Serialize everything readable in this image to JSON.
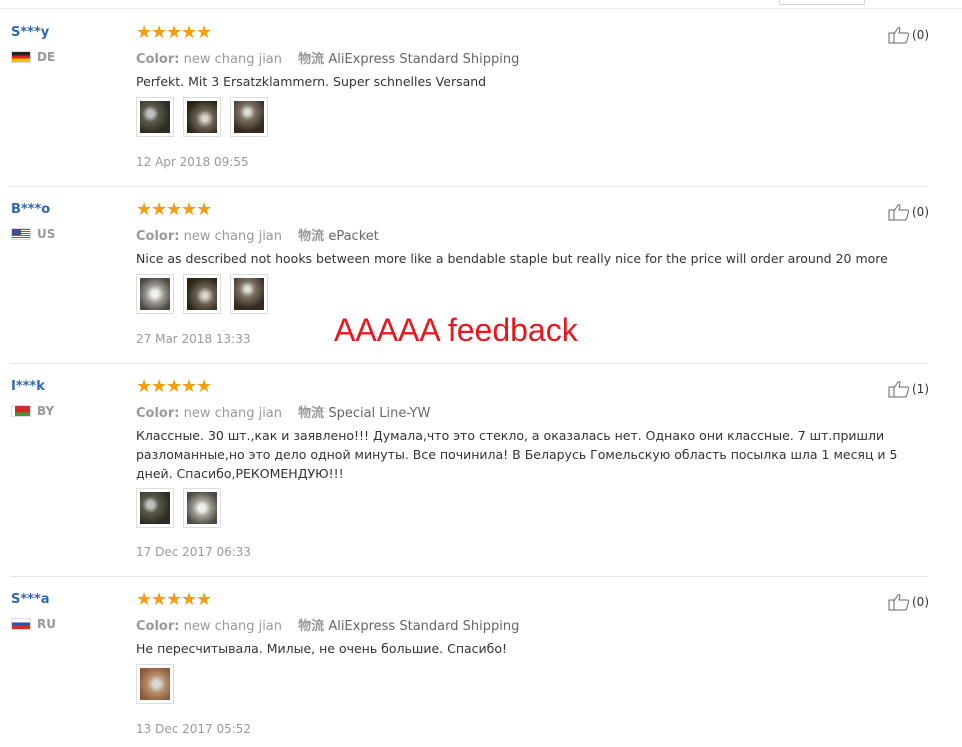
{
  "colors": {
    "stars": "#f29e0e",
    "username": "#2f66b3",
    "watermark": "#e8171f",
    "muted": "#999999"
  },
  "labels": {
    "color_label": "Color:",
    "shipping_label": "物流"
  },
  "watermark": "AAAAA feedback",
  "reviews": [
    {
      "user": "S***y",
      "country": "DE",
      "flag": "germany-flag",
      "rating": 5,
      "color": "new chang jian",
      "shipping": "AliExpress Standard Shipping",
      "text": "Perfekt. Mit 3 Ersatzklammern. Super schnelles Versand",
      "photos": 3,
      "date": "12 Apr 2018 09:55",
      "likes": "(0)"
    },
    {
      "user": "B***o",
      "country": "US",
      "flag": "usa-flag",
      "rating": 5,
      "color": "new chang jian",
      "shipping": "ePacket",
      "text": "Nice as described not hooks between more like a bendable staple but really nice for the price will order around 20 more",
      "photos": 3,
      "date": "27 Mar 2018 13:33",
      "likes": "(0)"
    },
    {
      "user": "I***k",
      "country": "BY",
      "flag": "belarus-flag",
      "rating": 5,
      "color": "new chang jian",
      "shipping": "Special Line-YW",
      "text": "Классные. 30 шт.,как и заявлено!!! Думала,что это стекло, а оказалась нет. Однако они классные. 7 шт.пришли разломанные,но это дело одной минуты. Все починила! В Беларусь Гомельскую область посылка шла 1 месяц и 5 дней. Спасибо,РЕКОМЕНДУЮ!!!",
      "photos": 2,
      "date": "17 Dec 2017 06:33",
      "likes": "(1)"
    },
    {
      "user": "S***a",
      "country": "RU",
      "flag": "russia-flag",
      "rating": 5,
      "color": "new chang jian",
      "shipping": "AliExpress Standard Shipping",
      "text": "Не пересчитывала. Милые, не очень большие. Спасибо!",
      "photos": 1,
      "date": "13 Dec 2017 05:52",
      "likes": "(0)"
    }
  ]
}
